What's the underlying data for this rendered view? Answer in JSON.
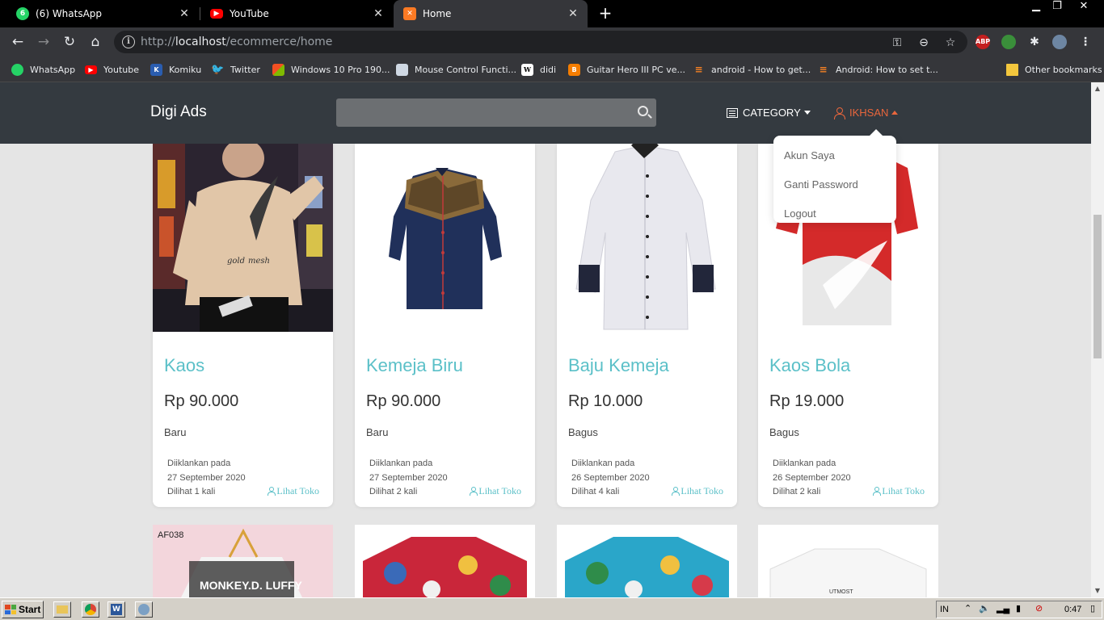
{
  "browser": {
    "tabs": [
      {
        "title": "(6) WhatsApp",
        "badge": "6",
        "icon": "whatsapp-icon"
      },
      {
        "title": "YouTube",
        "icon": "youtube-icon"
      },
      {
        "title": "Home",
        "icon": "xampp-icon",
        "active": true
      }
    ],
    "url_scheme": "http://",
    "url_host": "localhost",
    "url_path": "/ecommerce/home",
    "bookmarks": [
      {
        "label": "WhatsApp",
        "icon": "whatsapp-icon"
      },
      {
        "label": "Youtube",
        "icon": "youtube-icon"
      },
      {
        "label": "Komiku",
        "icon": "komiku-icon"
      },
      {
        "label": "Twitter",
        "icon": "twitter-icon"
      },
      {
        "label": "Windows 10 Pro 190...",
        "icon": "windows-icon"
      },
      {
        "label": "Mouse Control Functi...",
        "icon": "doc-icon"
      },
      {
        "label": "didi",
        "icon": "wikipedia-icon"
      },
      {
        "label": "Guitar Hero III PC ve...",
        "icon": "blogger-icon"
      },
      {
        "label": "android - How to get...",
        "icon": "stackoverflow-icon"
      },
      {
        "label": "Android: How to set t...",
        "icon": "stackoverflow-icon"
      },
      {
        "label": "Other bookmarks",
        "icon": "folder-icon"
      }
    ],
    "ext_abp": "ABP"
  },
  "site": {
    "brand": "Digi Ads",
    "search_placeholder": "",
    "nav_category": "CATEGORY",
    "nav_user": "IKHSAN",
    "dropdown": [
      "Akun Saya",
      "Ganti Password",
      "Logout"
    ],
    "accent": "#5bc0c8",
    "user_color": "#e9663c"
  },
  "products": [
    {
      "name": "Kaos",
      "price": "Rp 90.000",
      "condition": "Baru",
      "posted_label": "Diiklankan pada",
      "date": "27 September 2020",
      "views": "Dilihat 1 kali",
      "shop_link": "Lihat Toko"
    },
    {
      "name": "Kemeja Biru",
      "price": "Rp 90.000",
      "condition": "Baru",
      "posted_label": "Diiklankan pada",
      "date": "27 September 2020",
      "views": "Dilihat 2 kali",
      "shop_link": "Lihat Toko"
    },
    {
      "name": "Baju Kemeja",
      "price": "Rp 10.000",
      "condition": "Bagus",
      "posted_label": "Diiklankan pada",
      "date": "26 September 2020",
      "views": "Dilihat 4 kali",
      "shop_link": "Lihat Toko"
    },
    {
      "name": "Kaos Bola",
      "price": "Rp 19.000",
      "condition": "Bagus",
      "posted_label": "Diiklankan pada",
      "date": "26 September 2020",
      "views": "Dilihat 2 kali",
      "shop_link": "Lihat Toko"
    }
  ],
  "second_row_labels": {
    "af_code": "AF038",
    "shirt_text": "MONKEY.D. LUFFY",
    "tee_brand": "UTMOST"
  },
  "taskbar": {
    "start": "Start",
    "lang": "IN",
    "clock": "0:47"
  }
}
